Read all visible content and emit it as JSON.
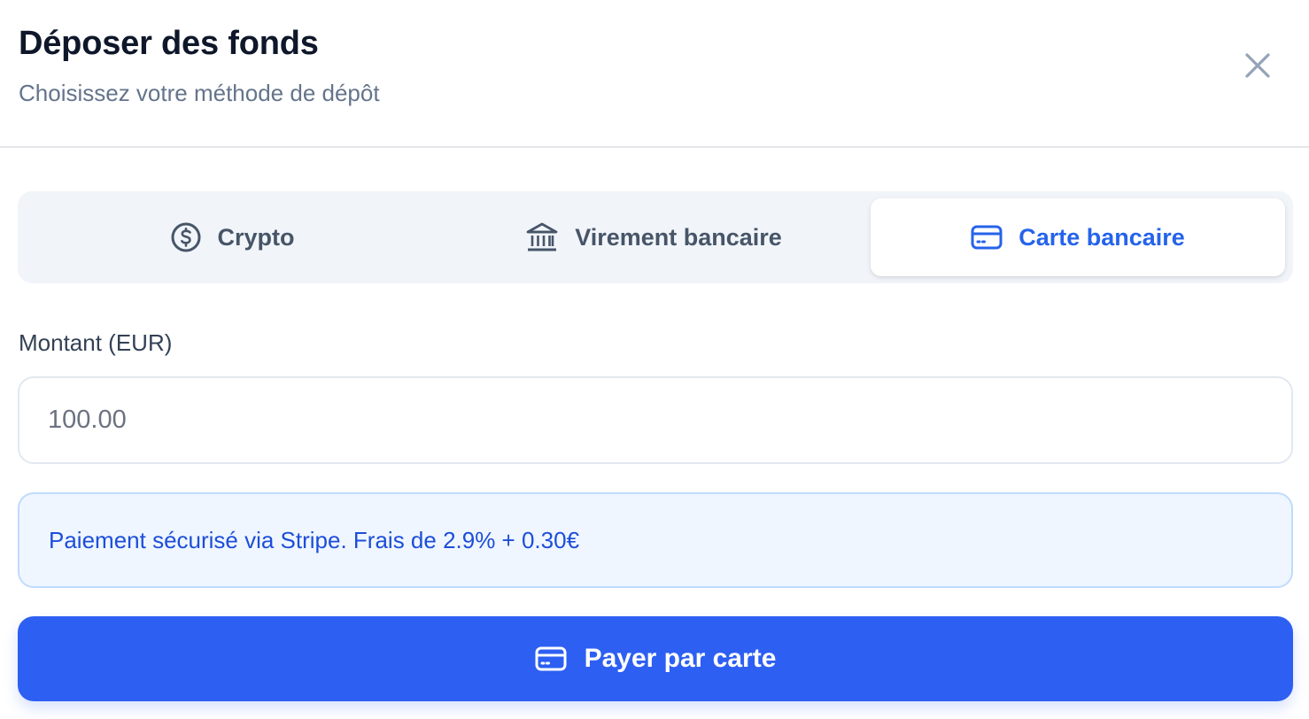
{
  "header": {
    "title": "Déposer des fonds",
    "subtitle": "Choisissez votre méthode de dépôt"
  },
  "tabs": [
    {
      "label": "Crypto",
      "icon": "dollar-circle-icon",
      "active": false
    },
    {
      "label": "Virement bancaire",
      "icon": "bank-icon",
      "active": false
    },
    {
      "label": "Carte bancaire",
      "icon": "credit-card-icon",
      "active": true
    }
  ],
  "amount": {
    "label": "Montant (EUR)",
    "placeholder": "100.00",
    "value": ""
  },
  "info": {
    "text": "Paiement sécurisé via Stripe. Frais de 2.9% + 0.30€"
  },
  "pay_button": {
    "label": "Payer par carte",
    "icon": "credit-card-icon"
  },
  "colors": {
    "accent": "#2563eb",
    "button": "#2d5ff3",
    "info_bg": "#eff6ff",
    "info_border": "#bfdbfe",
    "tabs_bg": "#f1f5f9"
  }
}
